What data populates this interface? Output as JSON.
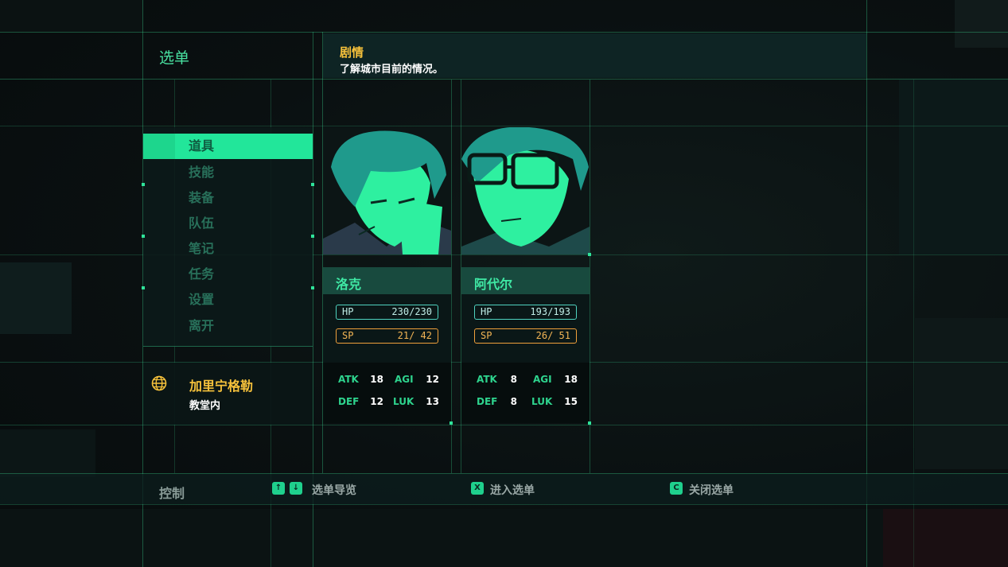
{
  "header": {
    "menu_title": "选单",
    "story_title": "剧情",
    "story_desc": "了解城市目前的情况。"
  },
  "menu": {
    "items": [
      {
        "label": "道具",
        "selected": true
      },
      {
        "label": "技能",
        "selected": false
      },
      {
        "label": "装备",
        "selected": false
      },
      {
        "label": "队伍",
        "selected": false
      },
      {
        "label": "笔记",
        "selected": false
      },
      {
        "label": "任务",
        "selected": false
      },
      {
        "label": "设置",
        "selected": false
      },
      {
        "label": "离开",
        "selected": false
      }
    ]
  },
  "location": {
    "icon": "globe-icon",
    "name": "加里宁格勒",
    "sub": "教堂内"
  },
  "party": [
    {
      "name": "洛克",
      "hp_label": "HP",
      "hp": "230/230",
      "sp_label": "SP",
      "sp": "21/ 42",
      "atk_label": "ATK",
      "atk": "18",
      "agi_label": "AGI",
      "agi": "12",
      "def_label": "DEF",
      "def": "12",
      "luk_label": "LUK",
      "luk": "13"
    },
    {
      "name": "阿代尔",
      "hp_label": "HP",
      "hp": "193/193",
      "sp_label": "SP",
      "sp": "26/ 51",
      "atk_label": "ATK",
      "atk": "8",
      "agi_label": "AGI",
      "agi": "18",
      "def_label": "DEF",
      "def": "8",
      "luk_label": "LUK",
      "luk": "15"
    }
  ],
  "controls": {
    "label": "控制",
    "hints": [
      {
        "keys": [
          "↑",
          "↓"
        ],
        "text": "选单导览"
      },
      {
        "keys": [
          "X"
        ],
        "text": "进入选单"
      },
      {
        "keys": [
          "C"
        ],
        "text": "关闭选单"
      }
    ]
  },
  "colors": {
    "accent": "#22e69a",
    "gold": "#f7c23b",
    "hp": "#4fd3c0",
    "sp": "#f0a03b"
  }
}
